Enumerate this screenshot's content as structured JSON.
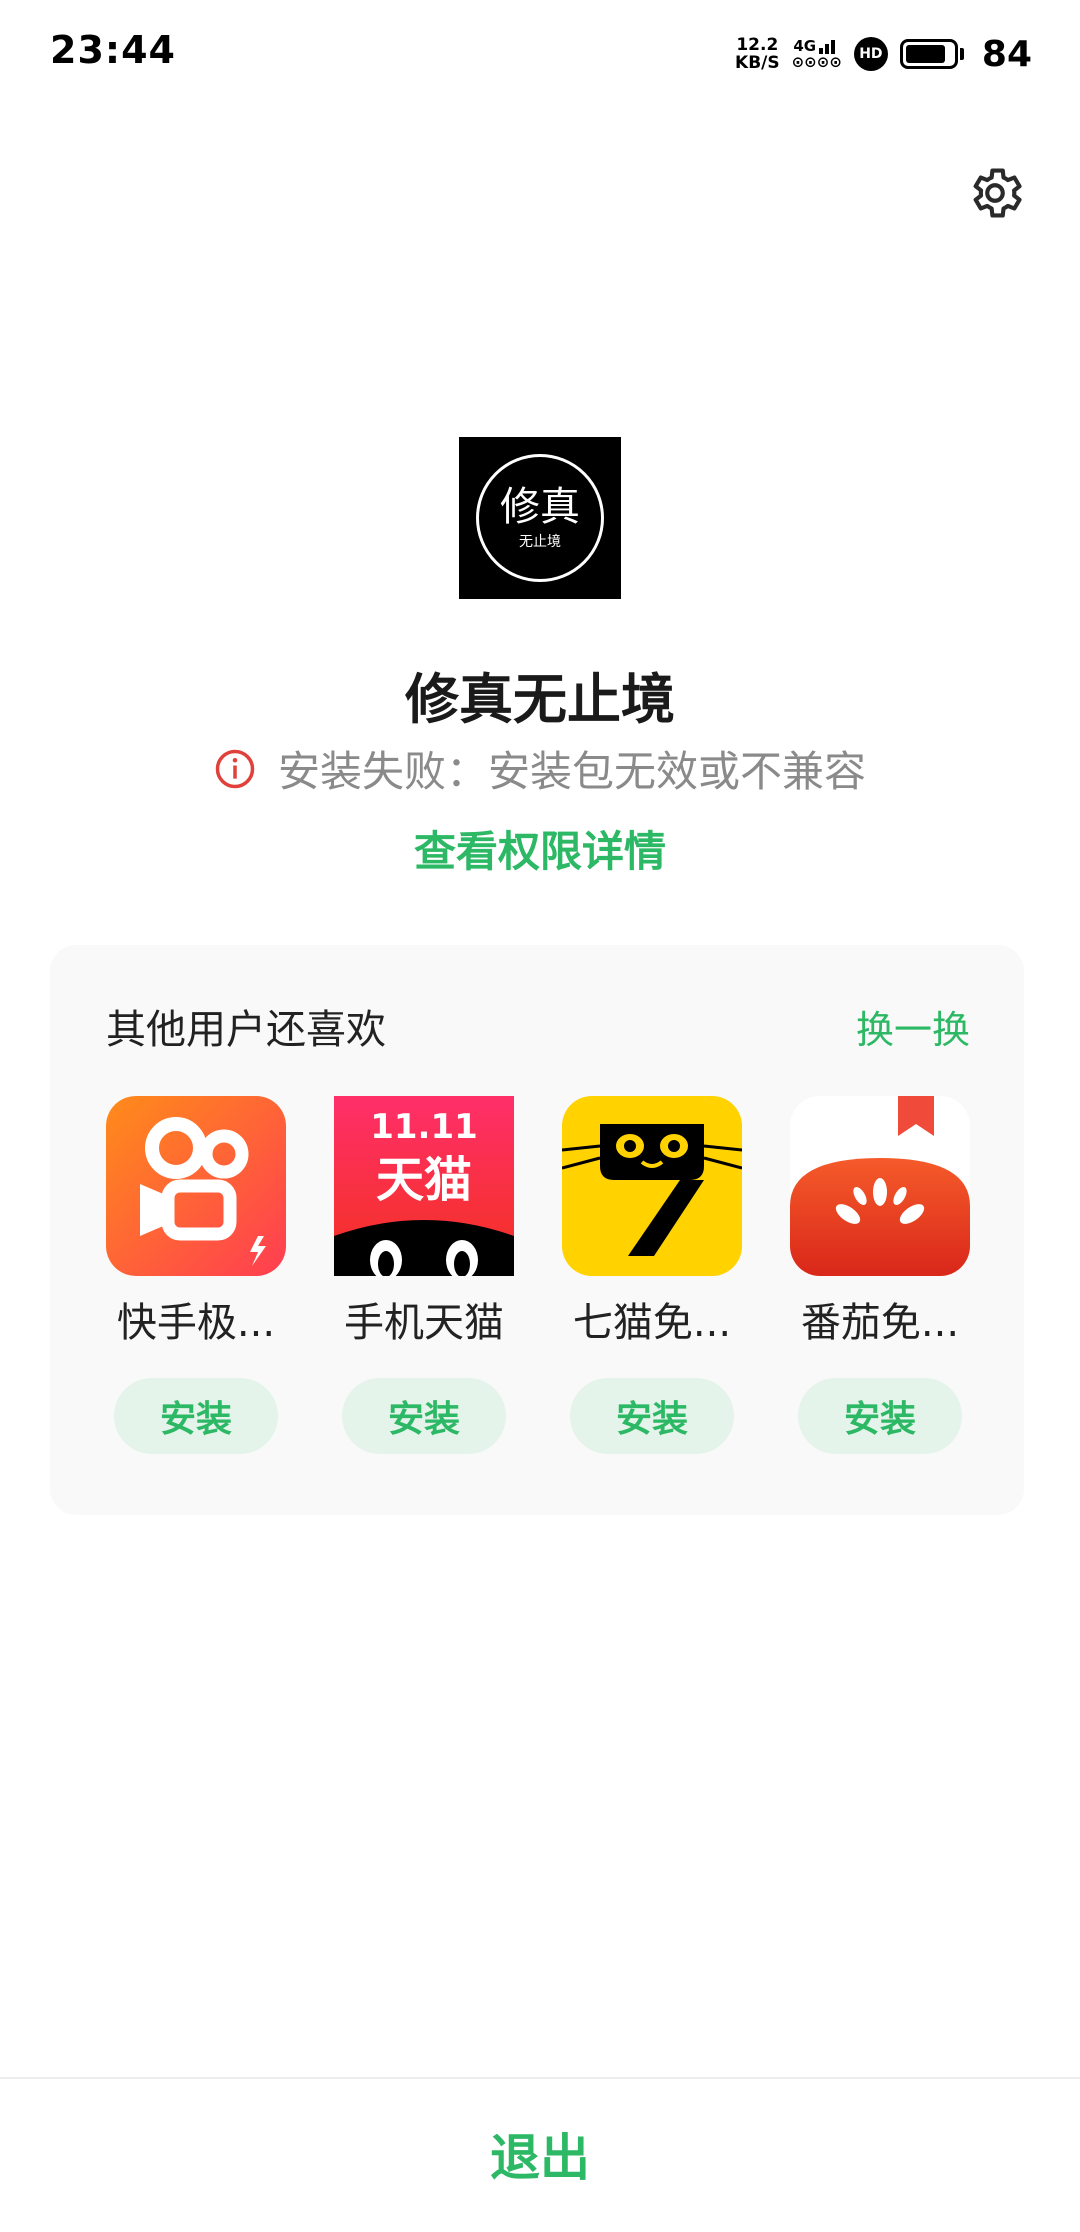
{
  "status_bar": {
    "time": "23:44",
    "net_speed_value": "12.2",
    "net_speed_unit": "KB/S",
    "network_type": "4G",
    "sim_dots": "⊙⊙⊙⊙",
    "hd_label": "HD",
    "battery_level": "84",
    "battery_fill_percent": 84
  },
  "app": {
    "icon_text_main": "修真",
    "icon_text_sub": "无止境",
    "name": "修真无止境",
    "error_message": "安装失败：安装包无效或不兼容",
    "permission_link": "查看权限详情"
  },
  "recommend": {
    "title": "其他用户还喜欢",
    "refresh_label": "换一换",
    "apps": [
      {
        "name": "快手极...",
        "install_label": "安装",
        "icon": "kuaishou-icon"
      },
      {
        "name": "手机天猫",
        "install_label": "安装",
        "icon": "tmall-icon",
        "icon_banner": "11.11",
        "icon_text": "天猫"
      },
      {
        "name": "七猫免...",
        "install_label": "安装",
        "icon": "qimao-icon"
      },
      {
        "name": "番茄免...",
        "install_label": "安装",
        "icon": "fanqie-icon"
      }
    ]
  },
  "bottom": {
    "exit_label": "退出"
  },
  "colors": {
    "accent": "#2cb864",
    "error": "#e0413b",
    "install_bg": "#e4f4ea",
    "card_bg": "#f9f9f9"
  }
}
